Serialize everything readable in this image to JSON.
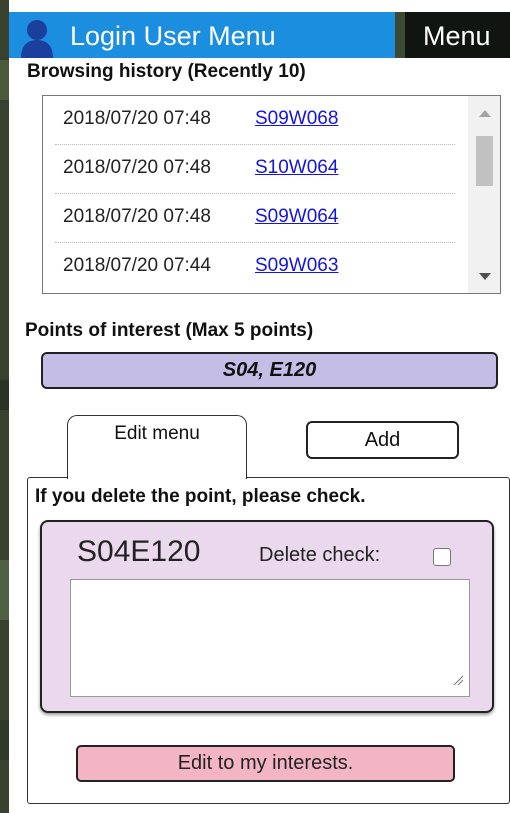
{
  "topbar": {
    "login_label": "Login User Menu",
    "menu_label": "Menu"
  },
  "history": {
    "heading": "Browsing history (Recently 10)",
    "rows": [
      {
        "time": "2018/07/20 07:48",
        "code": "S09W068"
      },
      {
        "time": "2018/07/20 07:48",
        "code": "S10W064"
      },
      {
        "time": "2018/07/20 07:48",
        "code": "S09W064"
      },
      {
        "time": "2018/07/20 07:44",
        "code": "S09W063"
      }
    ]
  },
  "poi": {
    "heading": "Points of interest (Max 5 points)",
    "selected": "S04, E120"
  },
  "tabs": {
    "edit_menu": "Edit menu",
    "add": "Add"
  },
  "edit": {
    "notice": "If you delete the point, please check.",
    "point_code": "S04E120",
    "delete_label": "Delete check:",
    "delete_checked": false,
    "note_value": "",
    "submit_label": "Edit to my interests."
  },
  "colors": {
    "login_bg": "#1c8ee0",
    "menu_bg": "#111511",
    "poi_pill": "#c4bde6",
    "card_bg": "#ead8ec",
    "submit_bg": "#f3b4c4",
    "link": "#1515dd"
  },
  "icons": {
    "login": "user-icon"
  }
}
